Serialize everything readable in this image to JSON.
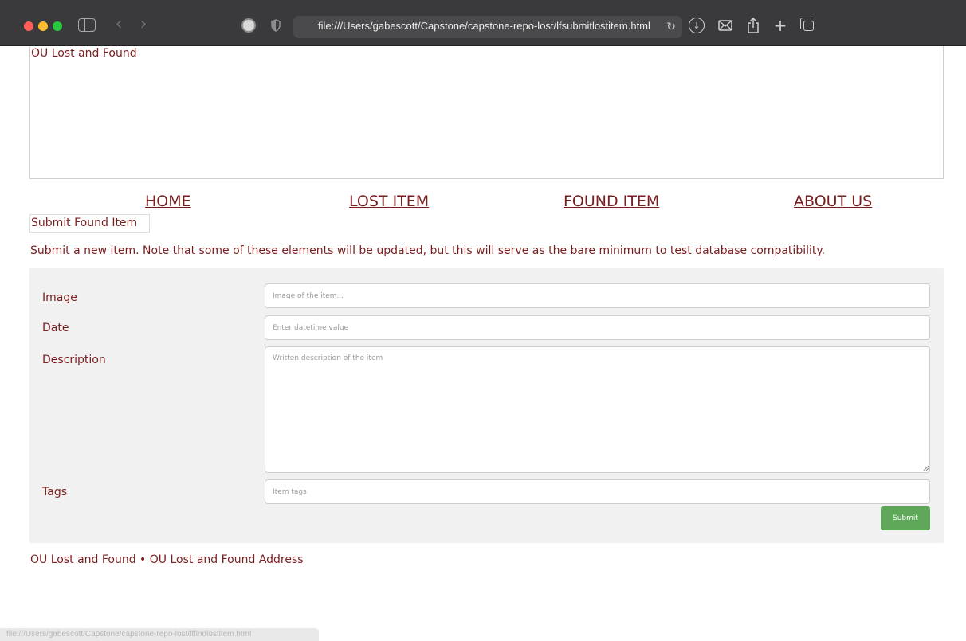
{
  "browser": {
    "url": "file:///Users/gabescott/Capstone/capstone-repo-lost/lfsubmitlostitem.html",
    "status_url": "file:///Users/gabescott/Capstone/capstone-repo-lost/lffindlostitem.html",
    "icons": [
      "sidebar-icon",
      "back-icon",
      "forward-icon",
      "extension-icon",
      "shield-icon",
      "reload-icon",
      "download-icon",
      "mail-icon",
      "share-icon",
      "new-tab-icon",
      "tabs-overview-icon"
    ]
  },
  "header": {
    "site_title": "OU Lost and Found"
  },
  "nav": {
    "home": "HOME",
    "lost": "LOST ITEM",
    "found": "FOUND ITEM",
    "about": "ABOUT US"
  },
  "page": {
    "heading": "Submit Found Item",
    "intro": "Submit a new item. Note that some of these elements will be updated, but this will serve as the bare minimum to test database compatibility."
  },
  "form": {
    "image_label": "Image",
    "image_placeholder": "Image of the item...",
    "date_label": "Date",
    "date_placeholder": "Enter datetime value",
    "description_label": "Description",
    "description_placeholder": "Written description of the item",
    "tags_label": "Tags",
    "tags_placeholder": "Item tags",
    "submit_label": "Submit"
  },
  "footer": {
    "text": "OU Lost and Found • OU Lost and Found Address"
  },
  "colors": {
    "text": "#7a1d1d",
    "submit": "#5fa85a",
    "panel": "#f1f1f1",
    "chrome": "#3a3a3c"
  }
}
